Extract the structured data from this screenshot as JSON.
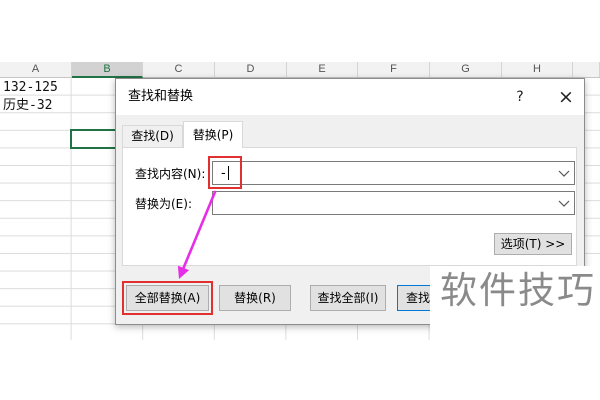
{
  "spreadsheet": {
    "columns": [
      "A",
      "B",
      "C",
      "D",
      "E",
      "F",
      "G",
      "H"
    ],
    "cells": {
      "A1": "132-125",
      "A2": "历史-32"
    }
  },
  "dialog": {
    "title": "查找和替换",
    "help_glyph": "?",
    "close_glyph": "×",
    "help_icon": "help-icon",
    "close_icon": "close-icon",
    "tabs": [
      {
        "label": "查找(D)",
        "selected": false
      },
      {
        "label": "替换(P)",
        "selected": true
      }
    ],
    "find": {
      "label": "查找内容(N):",
      "value": "-",
      "dropdown_icon": "chevron-down-icon"
    },
    "replace": {
      "label": "替换为(E):",
      "value": "",
      "dropdown_icon": "chevron-down-icon"
    },
    "options_button": "选项(T) >>",
    "buttons": {
      "replace_all": "全部替换(A)",
      "replace": "替换(R)",
      "find_all": "查找全部(I)",
      "find_next": "查找"
    }
  },
  "watermark": {
    "text": "软件技巧"
  },
  "colors": {
    "excel_green": "#217346",
    "highlight_red": "#e0302f",
    "arrow_magenta": "#e62ee6",
    "watermark_gray": "#8a8a8a"
  }
}
